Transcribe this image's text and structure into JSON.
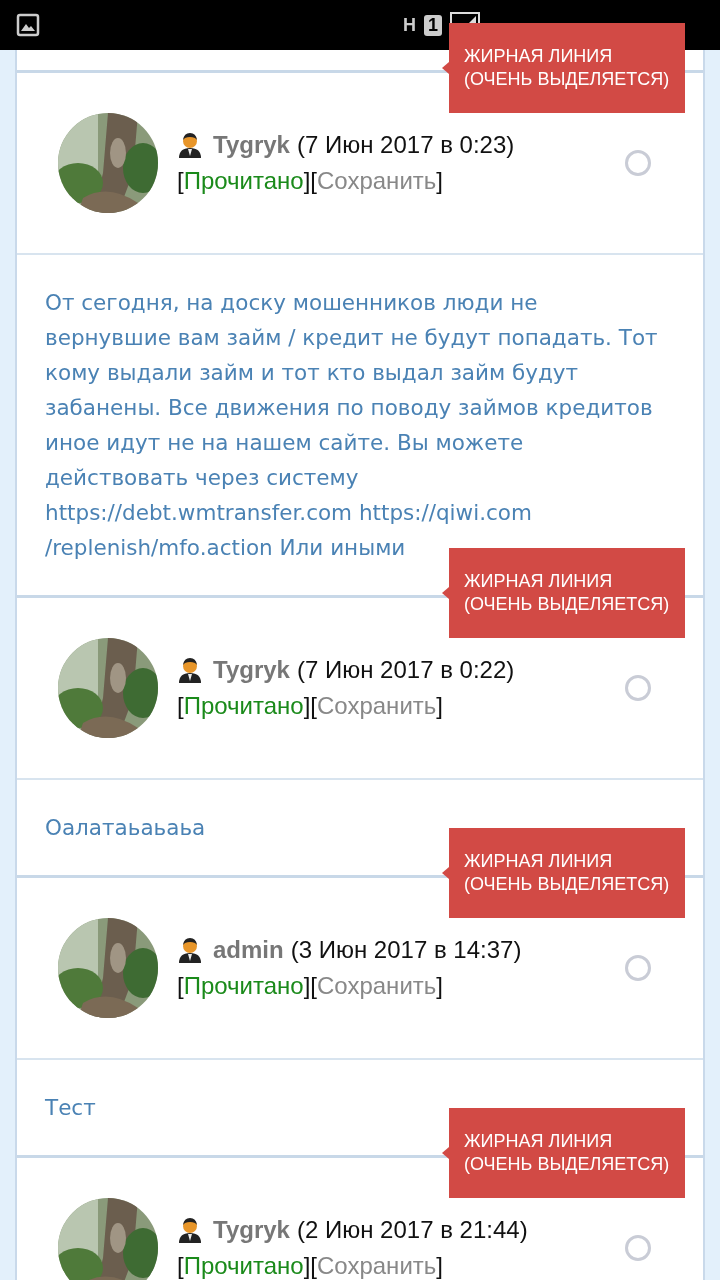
{
  "status_bar": {
    "network": "H",
    "sim": "1"
  },
  "items": [
    {
      "kind": "header",
      "author": "Tygryk",
      "date": "(7 Июн 2017 в 0:23)",
      "selected": false,
      "callout": "ЖИРНАЯ ЛИНИЯ\n(ОЧЕНЬ ВЫДЕЛЯЕТСЯ)",
      "actions": [
        {
          "kind": "read",
          "open": "[",
          "label": "Прочитано",
          "close": "]"
        },
        {
          "kind": "save",
          "open": "[",
          "label": "Сохранить",
          "close": "]"
        }
      ]
    },
    {
      "kind": "message",
      "text": "От сегодня, на доску мошенников люди не вернувшие вам займ / кредит не будут попадать. Тот кому выдали займ и тот кто выдал займ будут забанены. Все движения по поводу займов кредитов иное идут не на нашем сайте. Вы можете действовать через систему https://debt.wmtransfer.com https://qiwi.com /replenish/mfo.action Или иными"
    },
    {
      "kind": "header",
      "author": "Tygryk",
      "date": "(7 Июн 2017 в 0:22)",
      "selected": false,
      "callout": "ЖИРНАЯ ЛИНИЯ\n(ОЧЕНЬ ВЫДЕЛЯЕТСЯ)",
      "actions": [
        {
          "kind": "read",
          "open": "[",
          "label": "Прочитано",
          "close": "]"
        },
        {
          "kind": "save",
          "open": "[",
          "label": "Сохранить",
          "close": "]"
        }
      ]
    },
    {
      "kind": "message",
      "text": "Оалатаьаьаьа"
    },
    {
      "kind": "header",
      "author": "admin",
      "date": "(3 Июн 2017 в 14:37)",
      "selected": false,
      "callout": "ЖИРНАЯ ЛИНИЯ\n(ОЧЕНЬ ВЫДЕЛЯЕТСЯ)",
      "actions": [
        {
          "kind": "read",
          "open": "[",
          "label": "Прочитано",
          "close": "]"
        },
        {
          "kind": "save",
          "open": "[",
          "label": "Сохранить",
          "close": "]"
        }
      ]
    },
    {
      "kind": "message",
      "text": "Тест"
    },
    {
      "kind": "header",
      "author": "Tygryk",
      "date": "(2 Июн 2017 в 21:44)",
      "selected": false,
      "callout": "ЖИРНАЯ ЛИНИЯ\n(ОЧЕНЬ ВЫДЕЛЯЕТСЯ)",
      "actions": [
        {
          "kind": "read",
          "open": "[",
          "label": "Прочитано",
          "close": "]"
        },
        {
          "kind": "save",
          "open": "[",
          "label": "Сохранить",
          "close": "]"
        }
      ]
    }
  ]
}
